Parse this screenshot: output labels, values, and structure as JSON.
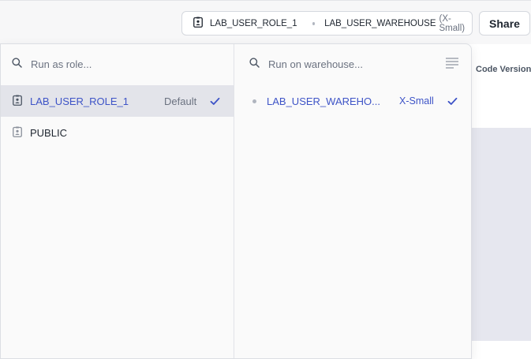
{
  "header": {
    "context": {
      "role": "LAB_USER_ROLE_1",
      "warehouse": "LAB_USER_WAREHOUSE",
      "warehouse_size": "(X-Small)"
    },
    "share_label": "Share"
  },
  "background": {
    "column_header": "Code Version"
  },
  "role_pane": {
    "search_placeholder": "Run as role...",
    "items": [
      {
        "label": "LAB_USER_ROLE_1",
        "badge": "Default",
        "selected": true
      },
      {
        "label": "PUBLIC",
        "selected": false
      }
    ]
  },
  "warehouse_pane": {
    "search_placeholder": "Run on warehouse...",
    "items": [
      {
        "label": "LAB_USER_WAREHO...",
        "size": "X-Small",
        "selected": true
      }
    ]
  },
  "colors": {
    "accent": "#3e54c7",
    "selected_row": "#e3e4ea",
    "muted_text": "#6b7280"
  },
  "icons": [
    "role-badge-icon",
    "search-icon",
    "checkmark-icon",
    "list-view-icon",
    "status-dot-icon"
  ]
}
